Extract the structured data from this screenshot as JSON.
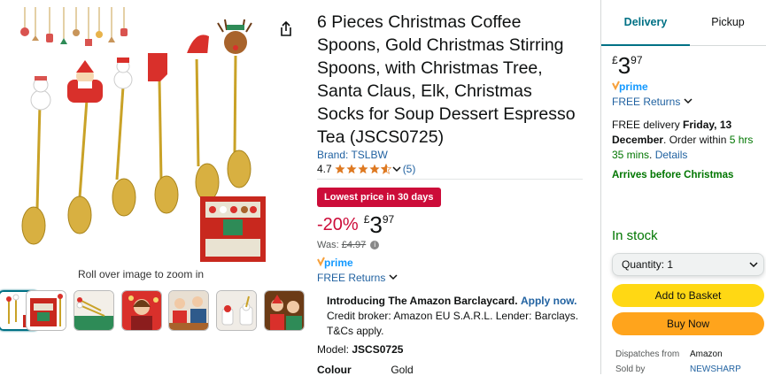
{
  "gallery": {
    "zoom_hint": "Roll over image to zoom in",
    "thumbnails": [
      {
        "icon": "spoon-set-thumbnail",
        "selected": true
      },
      {
        "icon": "product-box-thumbnail",
        "selected": false
      },
      {
        "icon": "spoons-on-tray-thumbnail",
        "selected": false
      },
      {
        "icon": "woman-with-cup-thumbnail",
        "selected": false
      },
      {
        "icon": "party-table-thumbnail",
        "selected": false
      },
      {
        "icon": "dessert-cups-thumbnail",
        "selected": false
      },
      {
        "icon": "family-christmas-thumbnail",
        "selected": false
      }
    ]
  },
  "product": {
    "title": "6 Pieces Christmas Coffee Spoons, Gold Christmas Stirring Spoons, with Christmas Tree, Santa Claus, Elk, Christmas Socks for Soup Dessert Espresso Tea (JSCS0725)",
    "brand": "Brand: TSLBW",
    "rating": "4.7",
    "rating_stars": 4.7,
    "review_count": "(5)",
    "deal_badge": "Lowest price in 30 days",
    "discount": "-20%",
    "currency": "£",
    "price_whole": "3",
    "price_fraction": "97",
    "was_label": "Was:",
    "was_price": "£4.97",
    "prime": "prime",
    "free_returns": "FREE Returns",
    "barclay_title": "Introducing The Amazon Barclaycard.",
    "barclay_apply": "Apply now.",
    "barclay_text": "Credit broker: Amazon EU S.A.R.L. Lender: Barclays. T&Cs apply.",
    "model_label": "Model:",
    "model_value": "JSCS0725",
    "colour_label": "Colour",
    "colour_value": "Gold"
  },
  "buybox": {
    "tab_delivery": "Delivery",
    "tab_pickup": "Pickup",
    "currency": "£",
    "price_whole": "3",
    "price_fraction": "97",
    "prime": "prime",
    "free_returns": "FREE Returns",
    "delivery_prefix": "FREE delivery",
    "delivery_date": "Friday, 13 December",
    "order_within": ". Order within",
    "countdown": "5 hrs 35 mins",
    "details": "Details",
    "arrives": "Arrives before Christmas",
    "stock": "In stock",
    "quantity_label": "Quantity:",
    "quantity_value": "1",
    "add_to_basket": "Add to Basket",
    "buy_now": "Buy Now",
    "dispatches_from_label": "Dispatches from",
    "dispatches_from_value": "Amazon",
    "sold_by_label": "Sold by",
    "sold_by_value": "NEWSHARP"
  },
  "colors": {
    "link": "#2162a1",
    "deal_red": "#cc0c39",
    "stock_green": "#007600",
    "star_orange": "#de7921",
    "basket_yellow": "#ffd814",
    "buy_orange": "#ffa41c",
    "tab_teal": "#007185",
    "prime_blue": "#1399ff"
  },
  "icons": {
    "share": "share-icon",
    "returns": "chevron-down-icon",
    "quantity": "chevron-down-icon",
    "info": "info-icon"
  }
}
